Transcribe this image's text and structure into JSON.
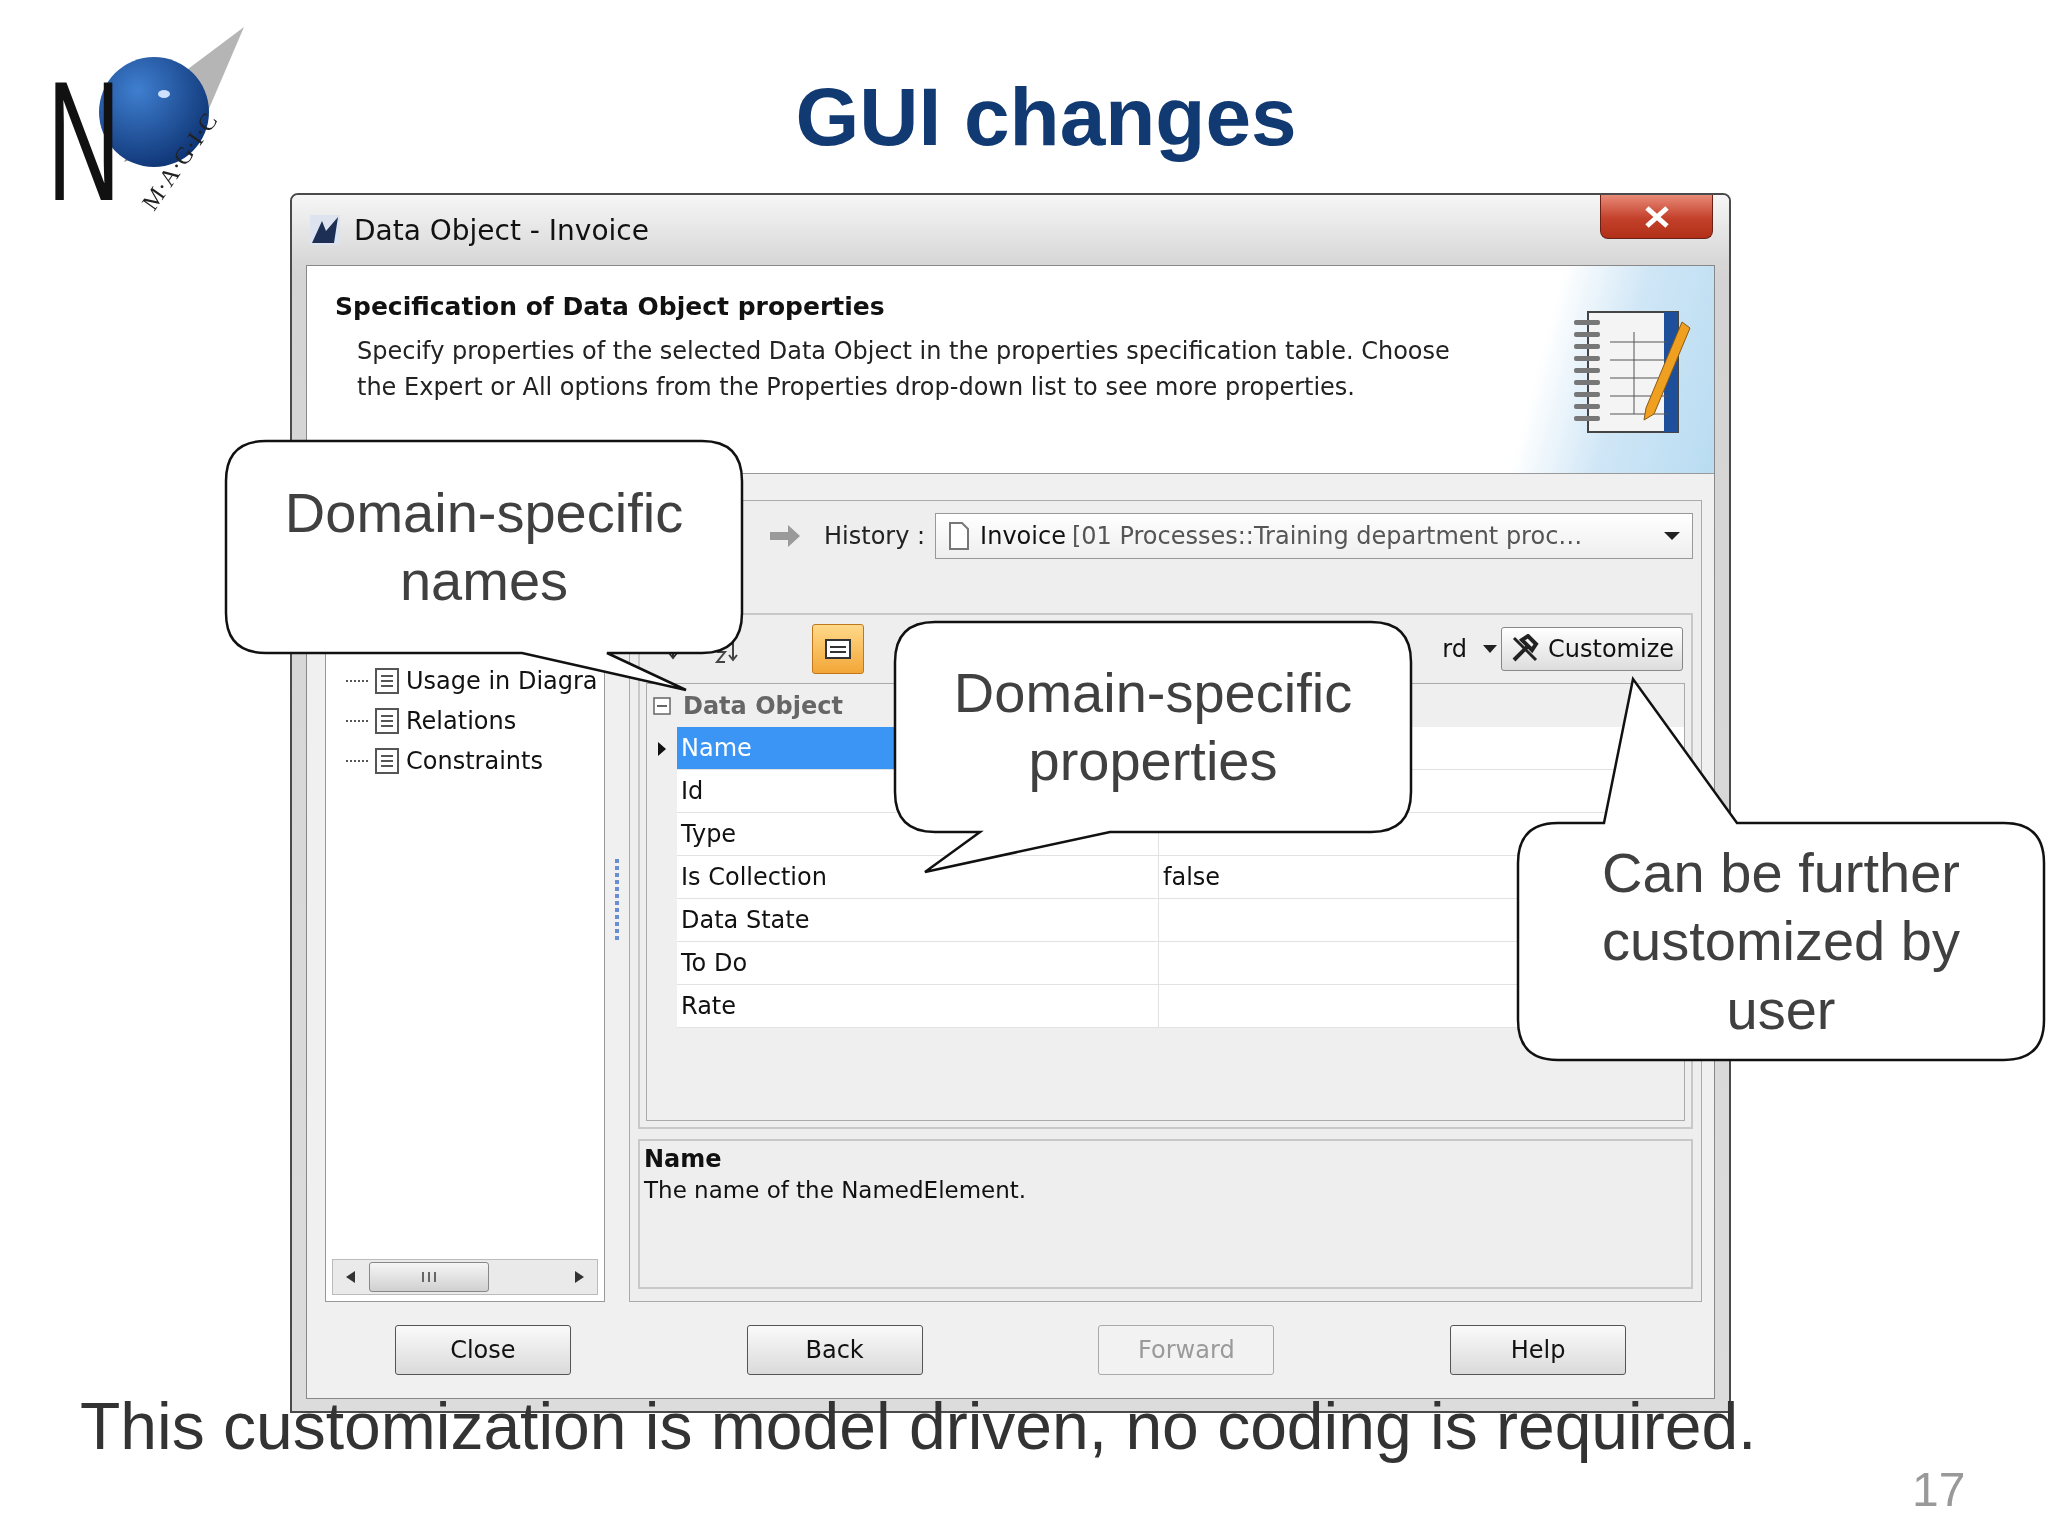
{
  "slide": {
    "logo": {
      "initial": "N",
      "word": "M·A·G·I·C"
    },
    "title": "GUI changes",
    "footer": "This customization is model driven, no coding is required.",
    "page_number": "17"
  },
  "dialog": {
    "title": "Data Object - Invoice",
    "header": {
      "heading": "Specification of Data Object properties",
      "description": "Specify properties of the selected Data Object in the properties specification table. Choose the Expert or All options from the Properties drop-down list to see more properties."
    },
    "tree": {
      "items": [
        "Usage in Diagra",
        "Relations",
        "Constraints"
      ]
    },
    "history": {
      "label": "History :",
      "value": "Invoice",
      "path": "[01 Processes::Training department proc…"
    },
    "toolbar": {
      "properties_dropdown": "rd",
      "customize": "Customize"
    },
    "properties": {
      "group": "Data Object",
      "expanded": true,
      "rows": [
        {
          "name": "Name",
          "selected": true
        },
        {
          "name": "Id",
          "selected": false
        },
        {
          "name": "Type",
          "selected": false
        },
        {
          "name": "Is Collection",
          "value": "false",
          "selected": false
        },
        {
          "name": "Data State",
          "selected": false
        },
        {
          "name": "To Do",
          "selected": false
        },
        {
          "name": "Rate",
          "selected": false
        }
      ]
    },
    "description": {
      "title": "Name",
      "text": "The name of the NamedElement."
    },
    "buttons": [
      {
        "label": "Close",
        "disabled": false
      },
      {
        "label": "Back",
        "disabled": false
      },
      {
        "label": "Forward",
        "disabled": true
      },
      {
        "label": "Help",
        "disabled": false
      }
    ]
  },
  "callouts": [
    {
      "text": "Domain-specific names"
    },
    {
      "text": "Domain-specific properties"
    },
    {
      "text": "Can be further customized by user"
    }
  ]
}
